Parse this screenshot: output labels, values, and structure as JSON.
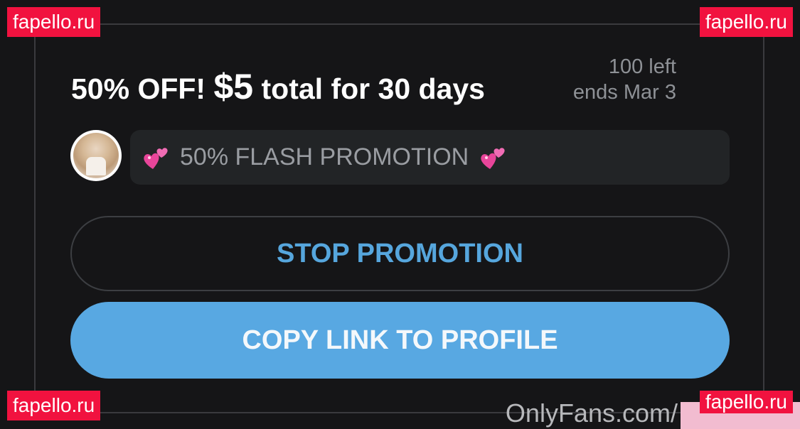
{
  "promotion": {
    "title_prefix": "50% OFF!",
    "price": "$5",
    "title_suffix": "total for 30 days",
    "remaining": "100 left",
    "ends": "ends Mar 3",
    "message": "50% FLASH PROMOTION"
  },
  "icons": {
    "message_left": "two-hearts-icon",
    "message_right": "two-hearts-icon",
    "heart_color": "#e8459a"
  },
  "buttons": {
    "stop": "STOP PROMOTION",
    "copy": "COPY LINK TO PROFILE"
  },
  "watermarks": {
    "top_left": "fapello.ru",
    "top_right": "fapello.ru",
    "bottom_left": "fapello.ru",
    "bottom_right": "fapello.ru",
    "onlyfans": "OnlyFans.com/"
  },
  "colors": {
    "accent": "#58a8e2",
    "background": "#151517",
    "watermark": "#f1123f"
  }
}
